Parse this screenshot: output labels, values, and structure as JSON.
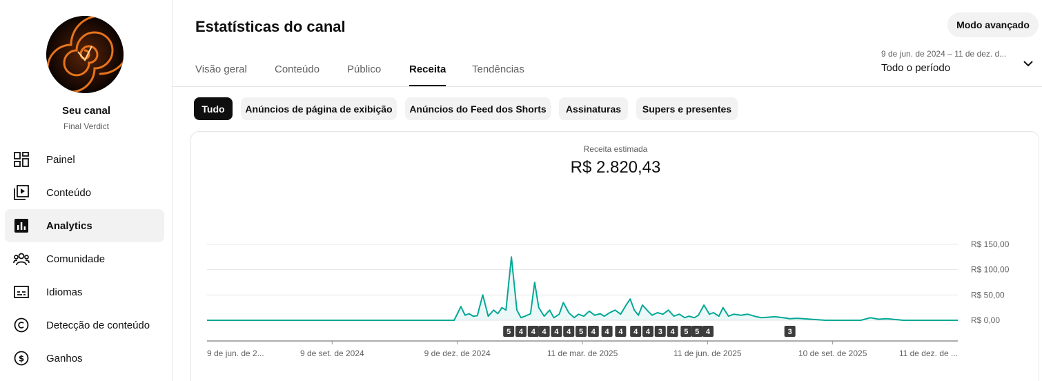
{
  "sidebar": {
    "channel_name": "Seu canal",
    "channel_handle": "Final Verdict",
    "items": [
      {
        "label": "Painel",
        "icon": "dashboard-icon",
        "active": false
      },
      {
        "label": "Conteúdo",
        "icon": "video-library-icon",
        "active": false
      },
      {
        "label": "Analytics",
        "icon": "analytics-icon",
        "active": true
      },
      {
        "label": "Comunidade",
        "icon": "community-icon",
        "active": false
      },
      {
        "label": "Idiomas",
        "icon": "subtitles-icon",
        "active": false
      },
      {
        "label": "Detecção de conteúdo",
        "icon": "copyright-icon",
        "active": false
      },
      {
        "label": "Ganhos",
        "icon": "dollar-icon",
        "active": false
      }
    ]
  },
  "header": {
    "title": "Estatísticas do canal",
    "advanced_mode": "Modo avançado",
    "date_range": "9 de jun. de 2024 – 11 de dez. d...",
    "period": "Todo o período"
  },
  "tabs": [
    {
      "label": "Visão geral",
      "active": false
    },
    {
      "label": "Conteúdo",
      "active": false
    },
    {
      "label": "Público",
      "active": false
    },
    {
      "label": "Receita",
      "active": true
    },
    {
      "label": "Tendências",
      "active": false
    }
  ],
  "chips": [
    {
      "label": "Tudo",
      "active": true
    },
    {
      "label": "Anúncios de página de exibição",
      "active": false
    },
    {
      "label": "Anúncios do Feed dos Shorts",
      "active": false
    },
    {
      "label": "Assinaturas",
      "active": false
    },
    {
      "label": "Supers e presentes",
      "active": false
    }
  ],
  "metric": {
    "label": "Receita estimada",
    "value": "R$ 2.820,43"
  },
  "colors": {
    "line": "#00a896",
    "grid": "#e5e5e5",
    "marker_bg": "#3c3c3c"
  },
  "chart_data": {
    "type": "line",
    "ylim": [
      0,
      150
    ],
    "y_ticks": [
      {
        "label": "R$ 150,00",
        "value": 150
      },
      {
        "label": "R$ 100,00",
        "value": 100
      },
      {
        "label": "R$ 50,00",
        "value": 50
      },
      {
        "label": "R$ 0,00",
        "value": 0
      }
    ],
    "x_tick_labels": [
      "9 de jun. de 2...",
      "9 de set. de 2024",
      "9 de dez. de 2024",
      "11 de mar. de 2025",
      "11 de jun. de 2025",
      "10 de set. de 2025",
      "11 de dez. de ..."
    ],
    "grid": true,
    "series": [
      {
        "x": [
          "2024-06-09",
          "2024-12-07",
          "2024-12-12",
          "2024-12-15",
          "2024-12-18",
          "2024-12-21",
          "2024-12-24",
          "2024-12-28",
          "2025-01-01",
          "2025-01-05",
          "2025-01-08",
          "2025-01-11",
          "2025-01-14",
          "2025-01-18",
          "2025-01-22",
          "2025-01-25",
          "2025-01-28",
          "2025-02-01",
          "2025-02-04",
          "2025-02-07",
          "2025-02-11",
          "2025-02-15",
          "2025-02-18",
          "2025-02-22",
          "2025-02-25",
          "2025-03-01",
          "2025-03-05",
          "2025-03-08",
          "2025-03-12",
          "2025-03-16",
          "2025-03-20",
          "2025-03-24",
          "2025-03-27",
          "2025-03-31",
          "2025-04-04",
          "2025-04-08",
          "2025-04-12",
          "2025-04-15",
          "2025-04-18",
          "2025-04-21",
          "2025-04-24",
          "2025-04-28",
          "2025-05-01",
          "2025-05-05",
          "2025-05-09",
          "2025-05-13",
          "2025-05-17",
          "2025-05-21",
          "2025-05-25",
          "2025-05-28",
          "2025-06-01",
          "2025-06-04",
          "2025-06-08",
          "2025-06-12",
          "2025-06-15",
          "2025-06-19",
          "2025-06-22",
          "2025-06-26",
          "2025-06-30",
          "2025-07-05",
          "2025-07-10",
          "2025-07-15",
          "2025-07-20",
          "2025-07-25",
          "2025-07-30",
          "2025-08-05",
          "2025-08-10",
          "2025-08-15",
          "2025-08-20",
          "2025-08-25",
          "2025-09-05",
          "2025-09-20",
          "2025-10-01",
          "2025-10-08",
          "2025-10-14",
          "2025-10-20",
          "2025-11-01",
          "2025-12-11"
        ],
        "values": [
          0,
          0,
          27,
          10,
          13,
          8,
          9,
          50,
          8,
          20,
          13,
          25,
          20,
          125,
          20,
          5,
          8,
          13,
          75,
          25,
          8,
          20,
          5,
          12,
          35,
          15,
          5,
          12,
          8,
          18,
          10,
          13,
          8,
          15,
          20,
          12,
          30,
          42,
          20,
          10,
          30,
          18,
          10,
          15,
          12,
          20,
          8,
          12,
          5,
          8,
          5,
          10,
          30,
          12,
          15,
          8,
          25,
          8,
          12,
          10,
          12,
          8,
          5,
          6,
          7,
          5,
          3,
          4,
          3,
          2,
          0,
          0,
          0,
          5,
          2,
          3,
          0,
          0
        ]
      }
    ],
    "markers": [
      {
        "x": "2025-01-16",
        "label": "5"
      },
      {
        "x": "2025-01-25",
        "label": "4"
      },
      {
        "x": "2025-02-03",
        "label": "4"
      },
      {
        "x": "2025-02-11",
        "label": "4"
      },
      {
        "x": "2025-02-20",
        "label": "4"
      },
      {
        "x": "2025-03-01",
        "label": "4"
      },
      {
        "x": "2025-03-10",
        "label": "5"
      },
      {
        "x": "2025-03-19",
        "label": "4"
      },
      {
        "x": "2025-03-29",
        "label": "4"
      },
      {
        "x": "2025-04-08",
        "label": "4"
      },
      {
        "x": "2025-04-19",
        "label": "4"
      },
      {
        "x": "2025-04-28",
        "label": "4"
      },
      {
        "x": "2025-05-07",
        "label": "3"
      },
      {
        "x": "2025-05-16",
        "label": "4"
      },
      {
        "x": "2025-05-26",
        "label": "5"
      },
      {
        "x": "2025-06-03",
        "label": "5"
      },
      {
        "x": "2025-06-11",
        "label": "4"
      },
      {
        "x": "2025-08-10",
        "label": "3"
      }
    ]
  }
}
